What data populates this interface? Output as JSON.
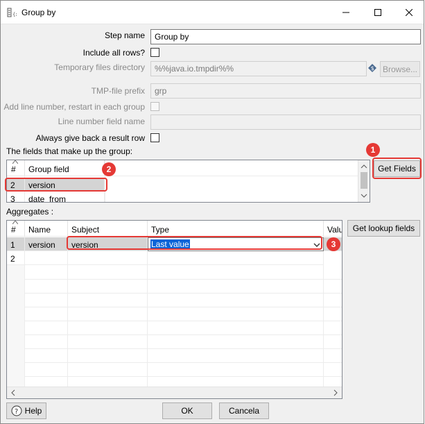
{
  "window": {
    "title": "Group by"
  },
  "form": {
    "step_name_label": "Step name",
    "step_name_value": "Group by",
    "include_all_rows_label": "Include all rows?",
    "temp_dir_label": "Temporary files directory",
    "temp_dir_value": "%%java.io.tmpdir%%",
    "browse_label": "Browse...",
    "tmp_prefix_label": "TMP-file prefix",
    "tmp_prefix_value": "grp",
    "add_line_number_label": "Add line number, restart in each group",
    "line_number_field_label": "Line number field name",
    "always_result_label": "Always give back a result row"
  },
  "group_fields": {
    "section_label": "The fields that make up the group:",
    "headers": {
      "num": "#",
      "field": "Group field"
    },
    "rows": [
      {
        "num": "2",
        "field": "version"
      },
      {
        "num": "3",
        "field": "date_from"
      }
    ],
    "get_fields_label": "Get Fields"
  },
  "aggregates": {
    "section_label": "Aggregates :",
    "headers": {
      "num": "#",
      "name": "Name",
      "subject": "Subject",
      "type": "Type",
      "value": "Valu"
    },
    "rows": [
      {
        "num": "1",
        "name": "version",
        "subject": "version",
        "type": "Last value"
      },
      {
        "num": "2",
        "name": "",
        "subject": "",
        "type": ""
      }
    ],
    "get_lookup_label": "Get lookup fields"
  },
  "annotations": {
    "badge1": "1",
    "badge2": "2",
    "badge3": "3"
  },
  "footer": {
    "help_label": "Help",
    "ok_label": "OK",
    "cancel_label": "Cancela"
  },
  "colors": {
    "annotation_red": "#e53935",
    "selection_blue": "#0a64d8"
  }
}
